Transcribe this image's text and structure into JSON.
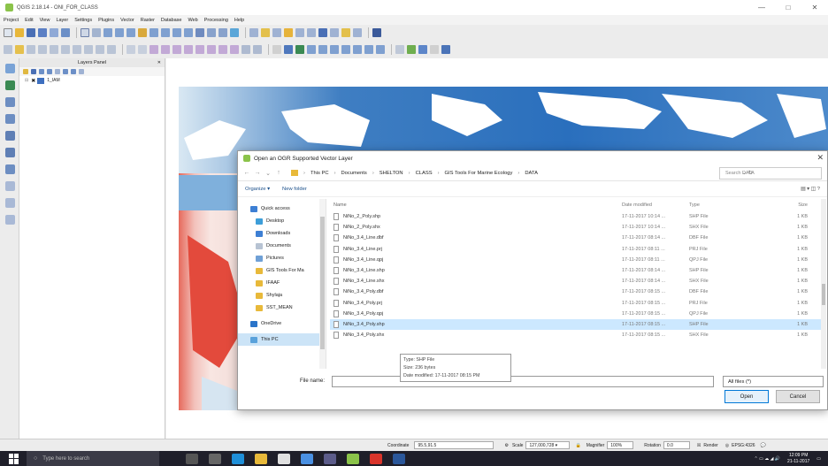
{
  "window": {
    "title": "QGIS 2.18.14 - ONI_FOR_CLASS",
    "controls": [
      "—",
      "□",
      "✕"
    ]
  },
  "menu": [
    "Project",
    "Edit",
    "View",
    "Layer",
    "Settings",
    "Plugins",
    "Vector",
    "Raster",
    "Database",
    "Web",
    "Processing",
    "Help"
  ],
  "layers_panel": {
    "title": "Layers Panel",
    "layer": "1_IAM"
  },
  "dialog": {
    "title": "Open an OGR Supported Vector Layer",
    "breadcrumb": [
      "This PC",
      "Documents",
      "SHELTON",
      "CLASS",
      "GIS Tools For Marine Ecology",
      "DATA"
    ],
    "search_placeholder": "Search DATA",
    "organize": "Organize ▾",
    "new_folder": "New folder",
    "nav": [
      "Quick access",
      "Desktop",
      "Downloads",
      "Documents",
      "Pictures",
      "GIS Tools For Ma",
      "IFAAF",
      "Shylaja",
      "SST_MEAN",
      "OneDrive",
      "This PC"
    ],
    "headers": {
      "name": "Name",
      "date": "Date modified",
      "type": "Type",
      "size": "Size"
    },
    "files": [
      {
        "name": "NiNo_2_Poly.shp",
        "date": "17-11-2017 10:14 ...",
        "type": "SHP File",
        "size": "1 KB"
      },
      {
        "name": "NiNo_2_Poly.shx",
        "date": "17-11-2017 10:14 ...",
        "type": "SHX File",
        "size": "1 KB"
      },
      {
        "name": "NiNo_3.4_Line.dbf",
        "date": "17-11-2017 08:14 ...",
        "type": "DBF File",
        "size": "1 KB"
      },
      {
        "name": "NiNo_3.4_Line.prj",
        "date": "17-11-2017 08:11 ...",
        "type": "PRJ File",
        "size": "1 KB"
      },
      {
        "name": "NiNo_3.4_Line.qpj",
        "date": "17-11-2017 08:11 ...",
        "type": "QPJ File",
        "size": "1 KB"
      },
      {
        "name": "NiNo_3.4_Line.shp",
        "date": "17-11-2017 08:14 ...",
        "type": "SHP File",
        "size": "1 KB"
      },
      {
        "name": "NiNo_3.4_Line.shx",
        "date": "17-11-2017 08:14 ...",
        "type": "SHX File",
        "size": "1 KB"
      },
      {
        "name": "NiNo_3.4_Poly.dbf",
        "date": "17-11-2017 08:15 ...",
        "type": "DBF File",
        "size": "1 KB"
      },
      {
        "name": "NiNo_3.4_Poly.prj",
        "date": "17-11-2017 08:15 ...",
        "type": "PRJ File",
        "size": "1 KB"
      },
      {
        "name": "NiNo_3.4_Poly.qpj",
        "date": "17-11-2017 08:15 ...",
        "type": "QPJ File",
        "size": "1 KB"
      },
      {
        "name": "NiNo_3.4_Poly.shp",
        "date": "17-11-2017 08:15 ...",
        "type": "SHP File",
        "size": "1 KB"
      },
      {
        "name": "NiNo_3.4_Poly.shx",
        "date": "17-11-2017 08:15 ...",
        "type": "SHX File",
        "size": "1 KB"
      }
    ],
    "tooltip": [
      "Type: SHP File",
      "Size: 236 bytes",
      "Date modified: 17-11-2017 08:15 PM"
    ],
    "file_name_label": "File name:",
    "filter": "All files (*)",
    "open": "Open",
    "cancel": "Cancel"
  },
  "status": {
    "coordinate_label": "Coordinate",
    "coordinate": "95.5,91.5",
    "scale_label": "Scale",
    "scale": "127,000,728 ▾",
    "magnifier_label": "Magnifier",
    "magnifier": "100%",
    "rotation_label": "Rotation",
    "rotation": "0.0",
    "render": "Render",
    "crs": "EPSG:4326"
  },
  "taskbar": {
    "search": "Type here to search",
    "time": "12:09 PM",
    "date": "21-11-2017"
  }
}
